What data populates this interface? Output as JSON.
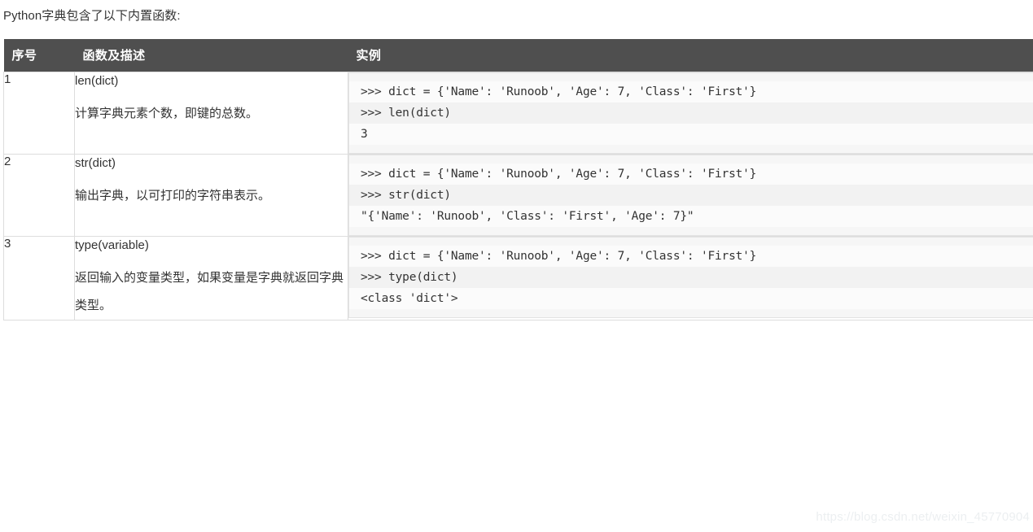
{
  "intro": "Python字典包含了以下内置函数:",
  "table": {
    "headers": {
      "no": "序号",
      "description": "函数及描述",
      "example": "实例"
    },
    "rows": [
      {
        "no": "1",
        "fn_name": "len(dict)",
        "fn_desc": "计算字典元素个数，即键的总数。",
        "code": [
          ">>> dict = {'Name': 'Runoob', 'Age': 7, 'Class': 'First'}",
          ">>> len(dict)",
          "3"
        ]
      },
      {
        "no": "2",
        "fn_name": "str(dict)",
        "fn_desc": "输出字典，以可打印的字符串表示。",
        "code": [
          ">>> dict = {'Name': 'Runoob', 'Age': 7, 'Class': 'First'}",
          ">>> str(dict)",
          "\"{'Name': 'Runoob', 'Class': 'First', 'Age': 7}\""
        ]
      },
      {
        "no": "3",
        "fn_name": "type(variable)",
        "fn_desc": "返回输入的变量类型，如果变量是字典就返回字典类型。",
        "code": [
          ">>> dict = {'Name': 'Runoob', 'Age': 7, 'Class': 'First'}",
          ">>> type(dict)",
          "<class 'dict'>"
        ]
      }
    ]
  },
  "watermark": "https://blog.csdn.net/weixin_45770904",
  "colors": {
    "header_bg": "#4f4f4f",
    "header_text": "#ffffff",
    "row_even_bg": "#f4f3f1",
    "row_odd_bg": "#ffffff",
    "code_bg": "#f6f6f6",
    "border": "#dddddd",
    "text": "#333333",
    "watermark": "#eceff1"
  }
}
